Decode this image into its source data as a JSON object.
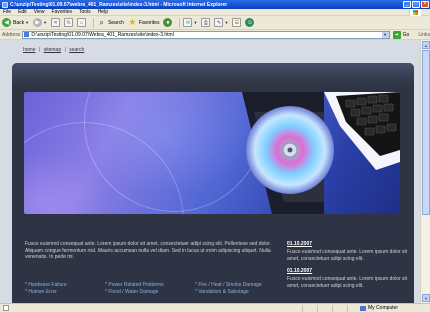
{
  "window": {
    "title": "C:\\unzip\\Testing\\01.09.07\\webra_401_Ramzes\\site\\index-3.html - Microsoft Internet Explorer",
    "buttons": {
      "minimize": "_",
      "maximize": "□",
      "close": "×"
    }
  },
  "menu": {
    "items": [
      "File",
      "Edit",
      "View",
      "Favorites",
      "Tools",
      "Help"
    ]
  },
  "toolbar": {
    "back_label": "Back",
    "search_label": "Search",
    "favorites_label": "Favorites"
  },
  "address": {
    "label": "Address",
    "value": "D:\\unzip\\Testing\\01.09.07\\Webra_401_Ramzes\\site\\index-3.html",
    "go_label": "Go",
    "links_label": "Links"
  },
  "site": {
    "nav": [
      "home",
      "sitemap",
      "search"
    ],
    "intro": "Fusce euismod consequat ante. Lorem ipsum dolor sit amet, consectetuer adipi scing elit. Pellentese sed dolor.  Aliquam congue fermentum nisl. Mauris accumsan nulla vel diam. Sed in lacus ut enim adipiscing aliquet. Nulla venenatis. In pede mi.",
    "links": [
      [
        "* Hardware Failure",
        "* Power Related Problems",
        "* Fire / Heat / Smoke Damage"
      ],
      [
        "* Human Error",
        "* Flood / Water Damage",
        "* Vandalism & Sabotage"
      ]
    ],
    "news": [
      {
        "date": "01.10.2007",
        "text": "Fusce euismod consequat ante. Lorem ipsum dolor sit amet, consectetuer adipi scing elit."
      },
      {
        "date": "01.10.2007",
        "text": "Fusce euismod consequat ante. Lorem ipsum dolor sit amet, consectetuer adipi scing elit."
      }
    ]
  },
  "status": {
    "zone_label": "My Computer"
  }
}
